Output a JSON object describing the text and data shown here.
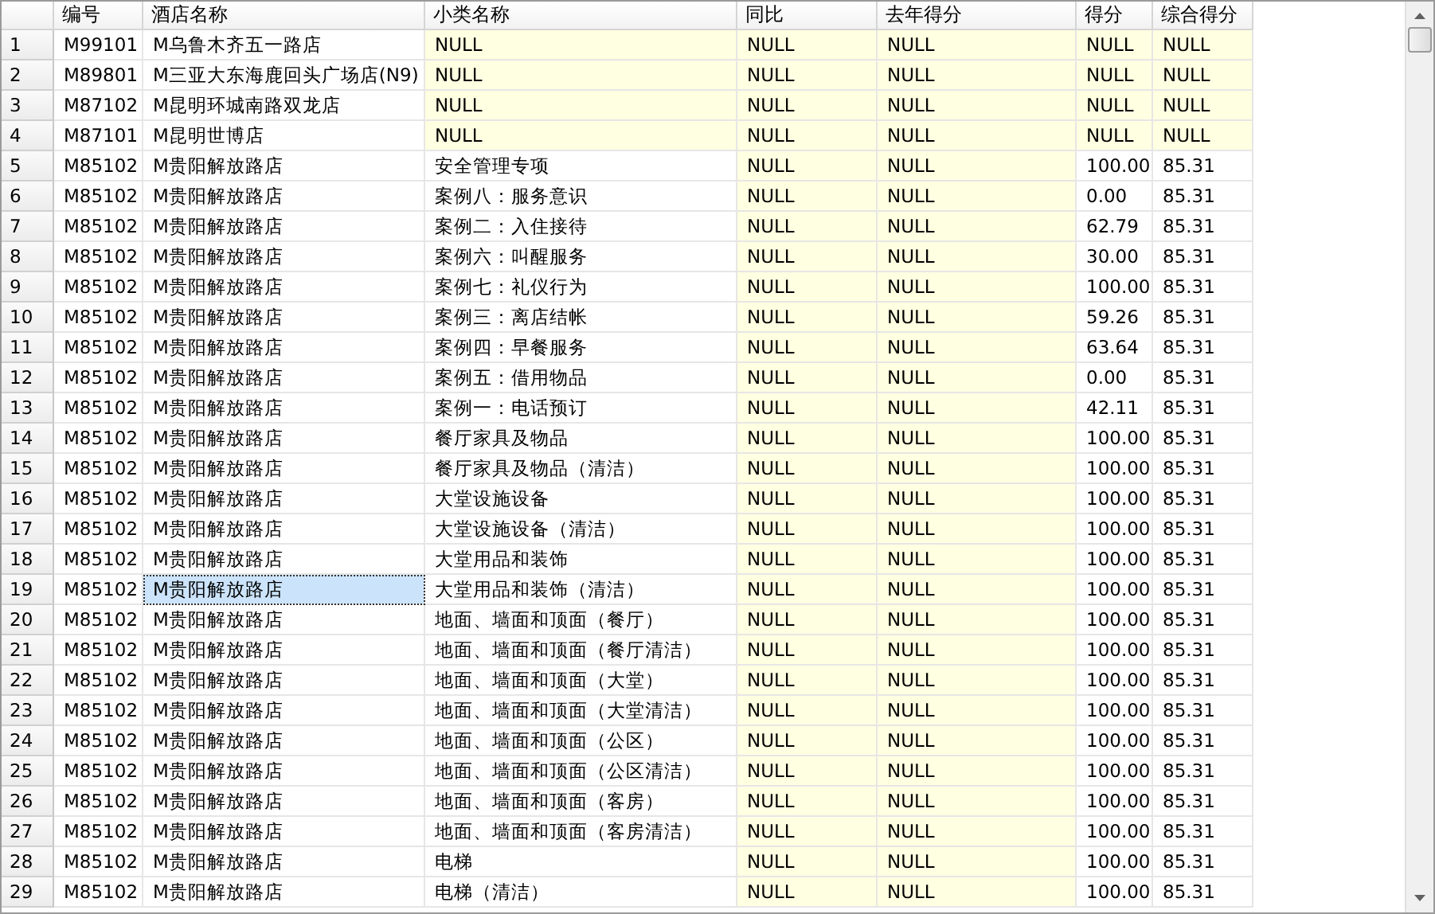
{
  "grid": {
    "columns": [
      "编号",
      "酒店名称",
      "小类名称",
      "同比",
      "去年得分",
      "得分",
      "综合得分"
    ],
    "rows": [
      {
        "number": "1",
        "values": [
          "M99101",
          "M乌鲁木齐五一路店",
          "NULL",
          "NULL",
          "NULL",
          "NULL",
          "NULL"
        ],
        "null": [
          false,
          false,
          true,
          true,
          true,
          true,
          true
        ],
        "selected": [
          false,
          false,
          false,
          false,
          false,
          false,
          false
        ]
      },
      {
        "number": "2",
        "values": [
          "M89801",
          "M三亚大东海鹿回头广场店(N9)",
          "NULL",
          "NULL",
          "NULL",
          "NULL",
          "NULL"
        ],
        "null": [
          false,
          false,
          true,
          true,
          true,
          true,
          true
        ],
        "selected": [
          false,
          false,
          false,
          false,
          false,
          false,
          false
        ]
      },
      {
        "number": "3",
        "values": [
          "M87102",
          "M昆明环城南路双龙店",
          "NULL",
          "NULL",
          "NULL",
          "NULL",
          "NULL"
        ],
        "null": [
          false,
          false,
          true,
          true,
          true,
          true,
          true
        ],
        "selected": [
          false,
          false,
          false,
          false,
          false,
          false,
          false
        ]
      },
      {
        "number": "4",
        "values": [
          "M87101",
          "M昆明世博店",
          "NULL",
          "NULL",
          "NULL",
          "NULL",
          "NULL"
        ],
        "null": [
          false,
          false,
          true,
          true,
          true,
          true,
          true
        ],
        "selected": [
          false,
          false,
          false,
          false,
          false,
          false,
          false
        ]
      },
      {
        "number": "5",
        "values": [
          "M85102",
          "M贵阳解放路店",
          "安全管理专项",
          "NULL",
          "NULL",
          "100.00",
          "85.31"
        ],
        "null": [
          false,
          false,
          false,
          true,
          true,
          false,
          false
        ],
        "selected": [
          false,
          false,
          false,
          false,
          false,
          false,
          false
        ]
      },
      {
        "number": "6",
        "values": [
          "M85102",
          "M贵阳解放路店",
          "案例八：服务意识",
          "NULL",
          "NULL",
          "0.00",
          "85.31"
        ],
        "null": [
          false,
          false,
          false,
          true,
          true,
          false,
          false
        ],
        "selected": [
          false,
          false,
          false,
          false,
          false,
          false,
          false
        ]
      },
      {
        "number": "7",
        "values": [
          "M85102",
          "M贵阳解放路店",
          "案例二：入住接待",
          "NULL",
          "NULL",
          "62.79",
          "85.31"
        ],
        "null": [
          false,
          false,
          false,
          true,
          true,
          false,
          false
        ],
        "selected": [
          false,
          false,
          false,
          false,
          false,
          false,
          false
        ]
      },
      {
        "number": "8",
        "values": [
          "M85102",
          "M贵阳解放路店",
          "案例六：叫醒服务",
          "NULL",
          "NULL",
          "30.00",
          "85.31"
        ],
        "null": [
          false,
          false,
          false,
          true,
          true,
          false,
          false
        ],
        "selected": [
          false,
          false,
          false,
          false,
          false,
          false,
          false
        ]
      },
      {
        "number": "9",
        "values": [
          "M85102",
          "M贵阳解放路店",
          "案例七：礼仪行为",
          "NULL",
          "NULL",
          "100.00",
          "85.31"
        ],
        "null": [
          false,
          false,
          false,
          true,
          true,
          false,
          false
        ],
        "selected": [
          false,
          false,
          false,
          false,
          false,
          false,
          false
        ]
      },
      {
        "number": "10",
        "values": [
          "M85102",
          "M贵阳解放路店",
          "案例三：离店结帐",
          "NULL",
          "NULL",
          "59.26",
          "85.31"
        ],
        "null": [
          false,
          false,
          false,
          true,
          true,
          false,
          false
        ],
        "selected": [
          false,
          false,
          false,
          false,
          false,
          false,
          false
        ]
      },
      {
        "number": "11",
        "values": [
          "M85102",
          "M贵阳解放路店",
          "案例四：早餐服务",
          "NULL",
          "NULL",
          "63.64",
          "85.31"
        ],
        "null": [
          false,
          false,
          false,
          true,
          true,
          false,
          false
        ],
        "selected": [
          false,
          false,
          false,
          false,
          false,
          false,
          false
        ]
      },
      {
        "number": "12",
        "values": [
          "M85102",
          "M贵阳解放路店",
          "案例五：借用物品",
          "NULL",
          "NULL",
          "0.00",
          "85.31"
        ],
        "null": [
          false,
          false,
          false,
          true,
          true,
          false,
          false
        ],
        "selected": [
          false,
          false,
          false,
          false,
          false,
          false,
          false
        ]
      },
      {
        "number": "13",
        "values": [
          "M85102",
          "M贵阳解放路店",
          "案例一：电话预订",
          "NULL",
          "NULL",
          "42.11",
          "85.31"
        ],
        "null": [
          false,
          false,
          false,
          true,
          true,
          false,
          false
        ],
        "selected": [
          false,
          false,
          false,
          false,
          false,
          false,
          false
        ]
      },
      {
        "number": "14",
        "values": [
          "M85102",
          "M贵阳解放路店",
          "餐厅家具及物品",
          "NULL",
          "NULL",
          "100.00",
          "85.31"
        ],
        "null": [
          false,
          false,
          false,
          true,
          true,
          false,
          false
        ],
        "selected": [
          false,
          false,
          false,
          false,
          false,
          false,
          false
        ]
      },
      {
        "number": "15",
        "values": [
          "M85102",
          "M贵阳解放路店",
          "餐厅家具及物品（清洁）",
          "NULL",
          "NULL",
          "100.00",
          "85.31"
        ],
        "null": [
          false,
          false,
          false,
          true,
          true,
          false,
          false
        ],
        "selected": [
          false,
          false,
          false,
          false,
          false,
          false,
          false
        ]
      },
      {
        "number": "16",
        "values": [
          "M85102",
          "M贵阳解放路店",
          "大堂设施设备",
          "NULL",
          "NULL",
          "100.00",
          "85.31"
        ],
        "null": [
          false,
          false,
          false,
          true,
          true,
          false,
          false
        ],
        "selected": [
          false,
          false,
          false,
          false,
          false,
          false,
          false
        ]
      },
      {
        "number": "17",
        "values": [
          "M85102",
          "M贵阳解放路店",
          "大堂设施设备（清洁）",
          "NULL",
          "NULL",
          "100.00",
          "85.31"
        ],
        "null": [
          false,
          false,
          false,
          true,
          true,
          false,
          false
        ],
        "selected": [
          false,
          false,
          false,
          false,
          false,
          false,
          false
        ]
      },
      {
        "number": "18",
        "values": [
          "M85102",
          "M贵阳解放路店",
          "大堂用品和装饰",
          "NULL",
          "NULL",
          "100.00",
          "85.31"
        ],
        "null": [
          false,
          false,
          false,
          true,
          true,
          false,
          false
        ],
        "selected": [
          false,
          false,
          false,
          false,
          false,
          false,
          false
        ]
      },
      {
        "number": "19",
        "values": [
          "M85102",
          "M贵阳解放路店",
          "大堂用品和装饰（清洁）",
          "NULL",
          "NULL",
          "100.00",
          "85.31"
        ],
        "null": [
          false,
          false,
          false,
          true,
          true,
          false,
          false
        ],
        "selected": [
          false,
          true,
          false,
          false,
          false,
          false,
          false
        ]
      },
      {
        "number": "20",
        "values": [
          "M85102",
          "M贵阳解放路店",
          "地面、墙面和顶面（餐厅）",
          "NULL",
          "NULL",
          "100.00",
          "85.31"
        ],
        "null": [
          false,
          false,
          false,
          true,
          true,
          false,
          false
        ],
        "selected": [
          false,
          false,
          false,
          false,
          false,
          false,
          false
        ]
      },
      {
        "number": "21",
        "values": [
          "M85102",
          "M贵阳解放路店",
          "地面、墙面和顶面（餐厅清洁）",
          "NULL",
          "NULL",
          "100.00",
          "85.31"
        ],
        "null": [
          false,
          false,
          false,
          true,
          true,
          false,
          false
        ],
        "selected": [
          false,
          false,
          false,
          false,
          false,
          false,
          false
        ]
      },
      {
        "number": "22",
        "values": [
          "M85102",
          "M贵阳解放路店",
          "地面、墙面和顶面（大堂）",
          "NULL",
          "NULL",
          "100.00",
          "85.31"
        ],
        "null": [
          false,
          false,
          false,
          true,
          true,
          false,
          false
        ],
        "selected": [
          false,
          false,
          false,
          false,
          false,
          false,
          false
        ]
      },
      {
        "number": "23",
        "values": [
          "M85102",
          "M贵阳解放路店",
          "地面、墙面和顶面（大堂清洁）",
          "NULL",
          "NULL",
          "100.00",
          "85.31"
        ],
        "null": [
          false,
          false,
          false,
          true,
          true,
          false,
          false
        ],
        "selected": [
          false,
          false,
          false,
          false,
          false,
          false,
          false
        ]
      },
      {
        "number": "24",
        "values": [
          "M85102",
          "M贵阳解放路店",
          "地面、墙面和顶面（公区）",
          "NULL",
          "NULL",
          "100.00",
          "85.31"
        ],
        "null": [
          false,
          false,
          false,
          true,
          true,
          false,
          false
        ],
        "selected": [
          false,
          false,
          false,
          false,
          false,
          false,
          false
        ]
      },
      {
        "number": "25",
        "values": [
          "M85102",
          "M贵阳解放路店",
          "地面、墙面和顶面（公区清洁）",
          "NULL",
          "NULL",
          "100.00",
          "85.31"
        ],
        "null": [
          false,
          false,
          false,
          true,
          true,
          false,
          false
        ],
        "selected": [
          false,
          false,
          false,
          false,
          false,
          false,
          false
        ]
      },
      {
        "number": "26",
        "values": [
          "M85102",
          "M贵阳解放路店",
          "地面、墙面和顶面（客房）",
          "NULL",
          "NULL",
          "100.00",
          "85.31"
        ],
        "null": [
          false,
          false,
          false,
          true,
          true,
          false,
          false
        ],
        "selected": [
          false,
          false,
          false,
          false,
          false,
          false,
          false
        ]
      },
      {
        "number": "27",
        "values": [
          "M85102",
          "M贵阳解放路店",
          "地面、墙面和顶面（客房清洁）",
          "NULL",
          "NULL",
          "100.00",
          "85.31"
        ],
        "null": [
          false,
          false,
          false,
          true,
          true,
          false,
          false
        ],
        "selected": [
          false,
          false,
          false,
          false,
          false,
          false,
          false
        ]
      },
      {
        "number": "28",
        "values": [
          "M85102",
          "M贵阳解放路店",
          "电梯",
          "NULL",
          "NULL",
          "100.00",
          "85.31"
        ],
        "null": [
          false,
          false,
          false,
          true,
          true,
          false,
          false
        ],
        "selected": [
          false,
          false,
          false,
          false,
          false,
          false,
          false
        ]
      },
      {
        "number": "29",
        "values": [
          "M85102",
          "M贵阳解放路店",
          "电梯（清洁）",
          "NULL",
          "NULL",
          "100.00",
          "85.31"
        ],
        "null": [
          false,
          false,
          false,
          true,
          true,
          false,
          false
        ],
        "selected": [
          false,
          false,
          false,
          false,
          false,
          false,
          false
        ]
      }
    ]
  }
}
